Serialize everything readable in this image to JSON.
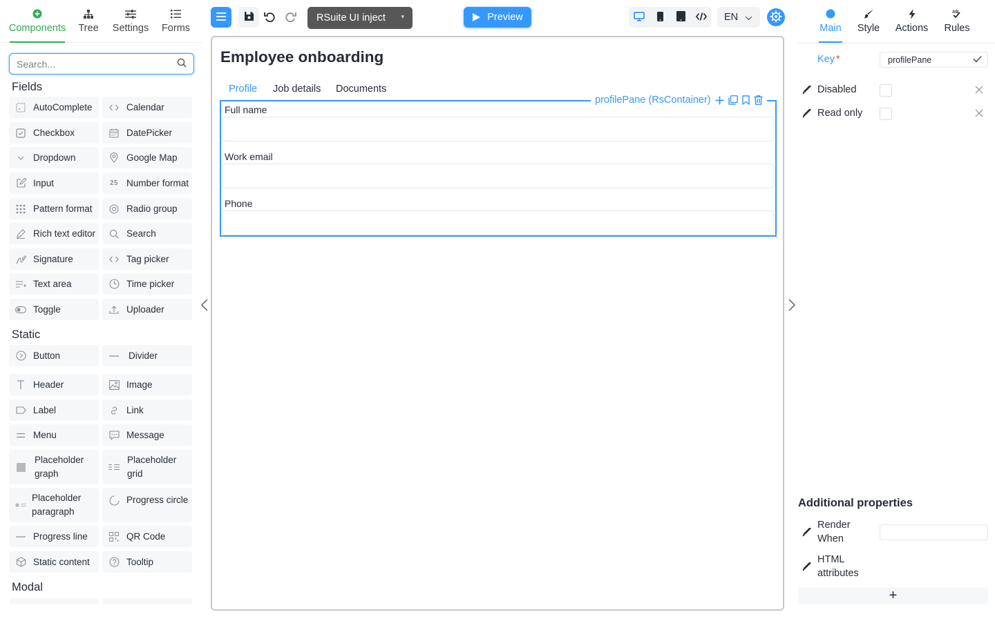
{
  "left_tabs": [
    {
      "label": "Components",
      "icon": "plus-circle-icon"
    },
    {
      "label": "Tree",
      "icon": "tree-icon"
    },
    {
      "label": "Settings",
      "icon": "sliders-icon"
    },
    {
      "label": "Forms",
      "icon": "list-icon"
    }
  ],
  "search": {
    "placeholder": "Search..."
  },
  "sections": {
    "fields": "Fields",
    "static": "Static",
    "modal": "Modal"
  },
  "fields": [
    {
      "label": "AutoComplete",
      "icon": "autocomplete-icon"
    },
    {
      "label": "Calendar",
      "icon": "code-brackets-icon"
    },
    {
      "label": "Checkbox",
      "icon": "checkbox-icon"
    },
    {
      "label": "DatePicker",
      "icon": "calendar-icon"
    },
    {
      "label": "Dropdown",
      "icon": "chevron-down-icon"
    },
    {
      "label": "Google Map",
      "icon": "map-pin-icon"
    },
    {
      "label": "Input",
      "icon": "edit-icon"
    },
    {
      "label": "Number format",
      "icon": "number-icon"
    },
    {
      "label": "Pattern format",
      "icon": "grid-dots-icon"
    },
    {
      "label": "Radio group",
      "icon": "radio-icon"
    },
    {
      "label": "Rich text editor",
      "icon": "pen-icon"
    },
    {
      "label": "Search",
      "icon": "search-icon"
    },
    {
      "label": "Signature",
      "icon": "signature-icon"
    },
    {
      "label": "Tag picker",
      "icon": "code-brackets-icon"
    },
    {
      "label": "Text area",
      "icon": "text-area-icon"
    },
    {
      "label": "Time picker",
      "icon": "clock-icon"
    },
    {
      "label": "Toggle",
      "icon": "toggle-icon"
    },
    {
      "label": "Uploader",
      "icon": "upload-icon"
    }
  ],
  "statics": [
    {
      "label": "Button",
      "icon": "button-icon"
    },
    {
      "label": "Divider",
      "icon": "divider-icon"
    },
    {
      "label": "Header",
      "icon": "header-icon"
    },
    {
      "label": "Image",
      "icon": "image-icon"
    },
    {
      "label": "Label",
      "icon": "label-icon"
    },
    {
      "label": "Link",
      "icon": "link-icon"
    },
    {
      "label": "Menu",
      "icon": "menu-icon"
    },
    {
      "label": "Message",
      "icon": "message-icon"
    },
    {
      "label": "Placeholder graph",
      "icon": "placeholder-graph-icon"
    },
    {
      "label": "Placeholder grid",
      "icon": "placeholder-grid-icon"
    },
    {
      "label": "Placeholder paragraph",
      "icon": "placeholder-paragraph-icon"
    },
    {
      "label": "Progress circle",
      "icon": "progress-circle-icon"
    },
    {
      "label": "Progress line",
      "icon": "progress-line-icon"
    },
    {
      "label": "QR Code",
      "icon": "qr-code-icon"
    },
    {
      "label": "Static content",
      "icon": "cube-icon"
    },
    {
      "label": "Tooltip",
      "icon": "help-circle-icon"
    }
  ],
  "toolbar": {
    "project_name": "RSuite UI inject",
    "preview_label": "Preview",
    "language": "EN"
  },
  "form": {
    "title": "Employee onboarding",
    "tabs": [
      "Profile",
      "Job details",
      "Documents"
    ],
    "active_tab": "Profile",
    "pane_label": "profilePane (RsContainer)",
    "fields": [
      {
        "label": "Full name",
        "value": ""
      },
      {
        "label": "Work email",
        "value": ""
      },
      {
        "label": "Phone",
        "value": ""
      }
    ]
  },
  "right_tabs": [
    {
      "label": "Main",
      "icon": "dot-icon"
    },
    {
      "label": "Style",
      "icon": "brush-icon"
    },
    {
      "label": "Actions",
      "icon": "lightning-icon"
    },
    {
      "label": "Rules",
      "icon": "rules-icon"
    }
  ],
  "properties": {
    "key_label": "Key",
    "key_required_mark": "*",
    "key_value": "profilePane",
    "disabled_label": "Disabled",
    "readonly_label": "Read only",
    "additional_title": "Additional properties",
    "render_when_label": "Render When",
    "html_attributes_label": "HTML attributes",
    "add_label": "+"
  },
  "colors": {
    "accent": "#3498ff",
    "components_tab": "#34a853",
    "required": "#f44336"
  }
}
